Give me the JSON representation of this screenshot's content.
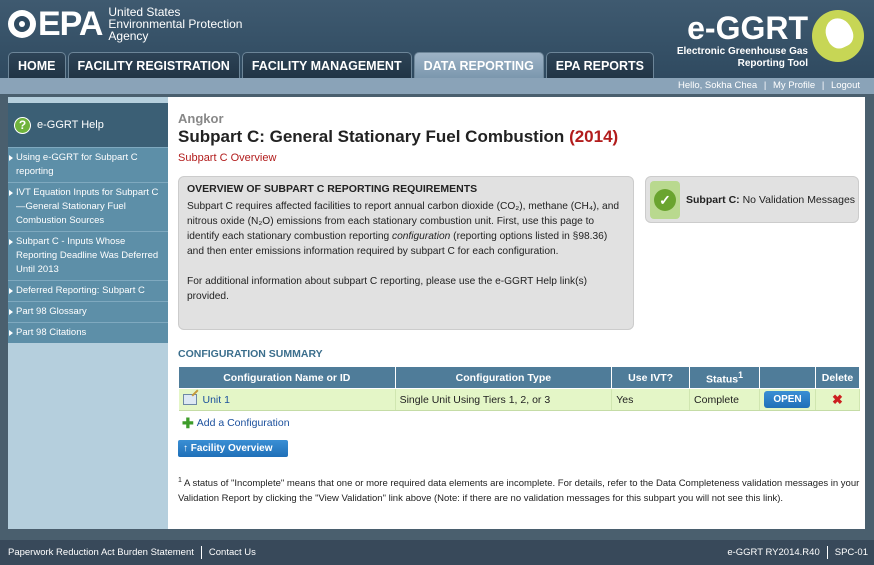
{
  "header": {
    "epa_word": "EPA",
    "agency_lines": [
      "United States",
      "Environmental Protection",
      "Agency"
    ],
    "app_title": "e-GGRT",
    "app_sub_lines": [
      "Electronic Greenhouse Gas",
      "Reporting Tool"
    ]
  },
  "tabs": [
    {
      "label": "HOME",
      "active": false
    },
    {
      "label": "FACILITY REGISTRATION",
      "active": false
    },
    {
      "label": "FACILITY MANAGEMENT",
      "active": false
    },
    {
      "label": "DATA REPORTING",
      "active": true
    },
    {
      "label": "EPA REPORTS",
      "active": false
    }
  ],
  "userbar": {
    "greeting": "Hello, Sokha Chea",
    "my_profile": "My Profile",
    "logout": "Logout"
  },
  "sidebar": {
    "title": "e-GGRT Help",
    "items": [
      "Using e-GGRT for Subpart C reporting",
      "IVT Equation Inputs for Subpart C—General Stationary Fuel Combustion Sources",
      "Subpart C - Inputs Whose Reporting Deadline Was Deferred Until 2013",
      "Deferred Reporting: Subpart C",
      "Part 98 Glossary",
      "Part 98 Citations"
    ]
  },
  "main": {
    "facility": "Angkor",
    "title": "Subpart C: General Stationary Fuel Combustion",
    "year": "(2014)",
    "subtitle": "Subpart C Overview",
    "overview_heading": "OVERVIEW OF SUBPART C REPORTING REQUIREMENTS",
    "overview_p1_a": "Subpart C requires affected facilities to report annual carbon dioxide (CO₂), methane (CH₄), and nitrous oxide (N₂O) emissions from each stationary combustion unit. First, use this page to identify each stationary combustion reporting ",
    "overview_p1_em": "configuration",
    "overview_p1_b": " (reporting options listed in §98.36) and then enter emissions information required by subpart C for each configuration.",
    "overview_p2": "For additional information about subpart C reporting, please use the e-GGRT Help link(s) provided.",
    "validation_label": "Subpart C:",
    "validation_text": "No Validation Messages",
    "config_heading": "CONFIGURATION SUMMARY",
    "columns": {
      "name": "Configuration Name or ID",
      "type": "Configuration Type",
      "ivt": "Use IVT?",
      "status": "Status",
      "status_sup": "1",
      "blank": "",
      "delete": "Delete"
    },
    "rows": [
      {
        "name": "Unit 1",
        "type": "Single Unit Using Tiers 1, 2, or 3",
        "ivt": "Yes",
        "status": "Complete",
        "open": "OPEN",
        "delete_icon": "✖"
      }
    ],
    "add_config": "Add a Configuration",
    "facility_overview_btn": "Facility Overview",
    "footnote_sup": "1",
    "footnote": " A status of \"Incomplete\" means that one or more required data elements are incomplete. For details, refer to the Data Completeness validation messages in your Validation Report by clicking the \"View Validation\" link above (Note: if there are no validation messages for this subpart you will not see this link)."
  },
  "footer": {
    "paperwork": "Paperwork Reduction Act Burden Statement",
    "contact": "Contact Us",
    "version": "e-GGRT RY2014.R40",
    "page_code": "SPC-01"
  }
}
